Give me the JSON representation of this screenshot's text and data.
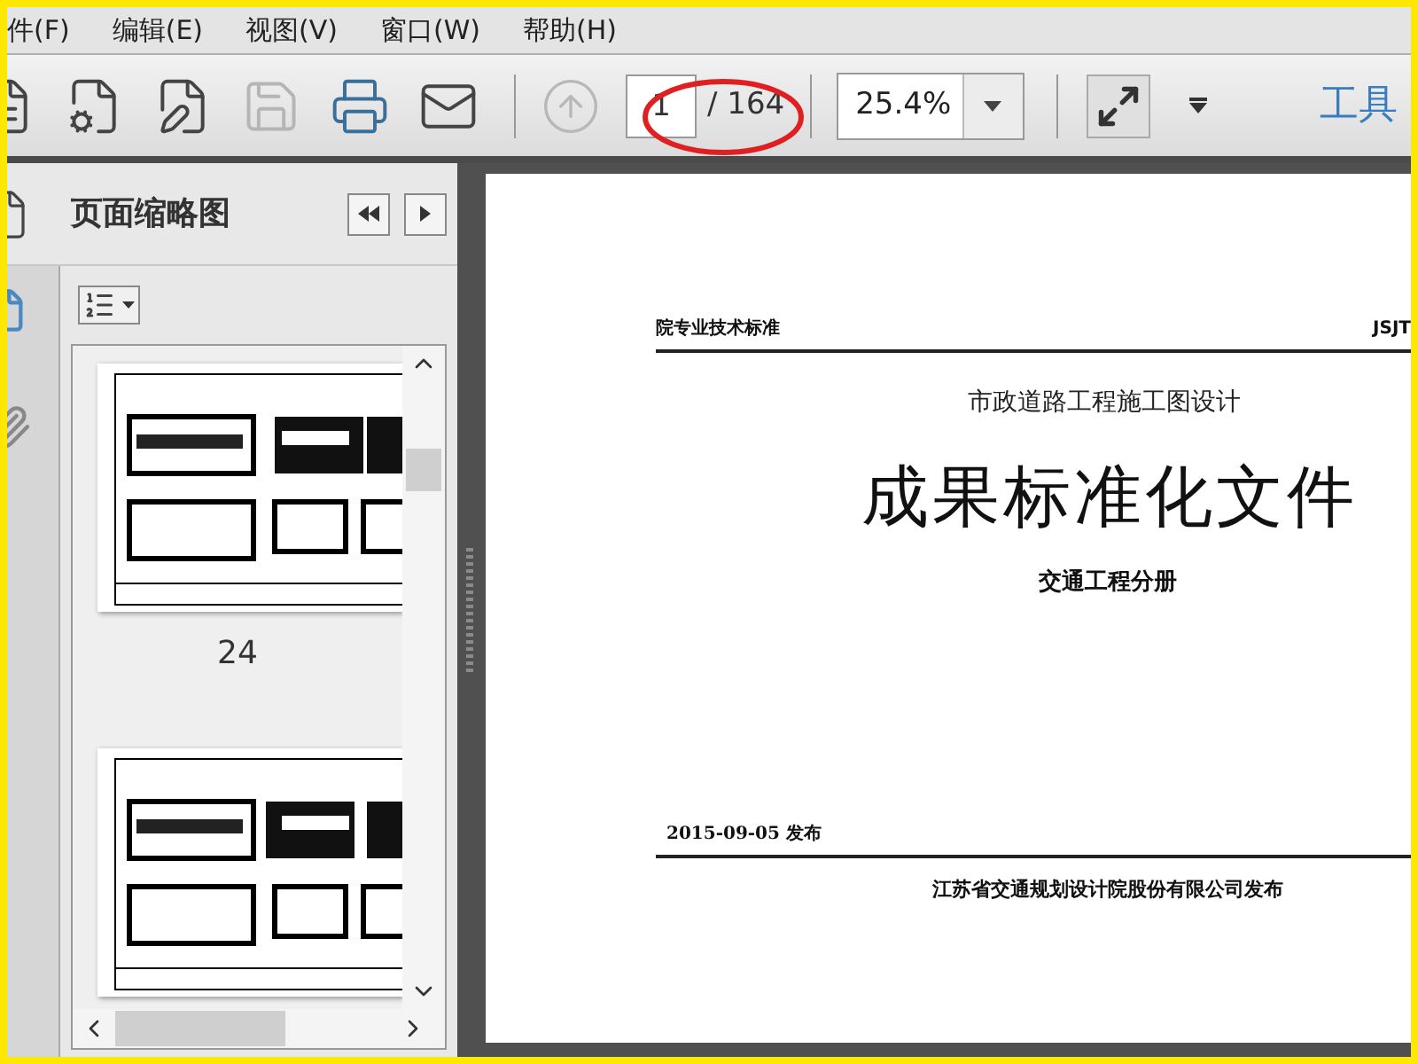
{
  "menu": [
    {
      "label": "件(F)"
    },
    {
      "label": "编辑(E)"
    },
    {
      "label": "视图(V)"
    },
    {
      "label": "窗口(W)"
    },
    {
      "label": "帮助(H)"
    }
  ],
  "toolbar": {
    "buttons": [
      {
        "kind": "document",
        "disabled": false
      },
      {
        "kind": "create",
        "disabled": false
      },
      {
        "kind": "edit",
        "disabled": false
      },
      {
        "kind": "save",
        "disabled": true
      },
      {
        "kind": "print",
        "disabled": false
      },
      {
        "kind": "mail",
        "disabled": false
      }
    ],
    "previous_page": {
      "disabled": true
    },
    "page_field": {
      "value": "1"
    },
    "page_total": "/ 164",
    "zoom_field": {
      "value": "25.4%"
    },
    "tools_label": "工具"
  },
  "sidebar": {
    "title": "页面缩略图",
    "thumbnails": [
      {
        "kind": "picture",
        "label": "24"
      },
      {
        "kind": "picture"
      }
    ]
  },
  "document": {
    "header_left": "院专业技术标准",
    "header_right": "JSJT",
    "subtitle": "市政道路工程施工图设计",
    "title": "成果标准化文件",
    "volume": "交通工程分册",
    "date": "2015-09-05 发布",
    "publisher": "江苏省交通规划设计院股份有限公司发布"
  }
}
